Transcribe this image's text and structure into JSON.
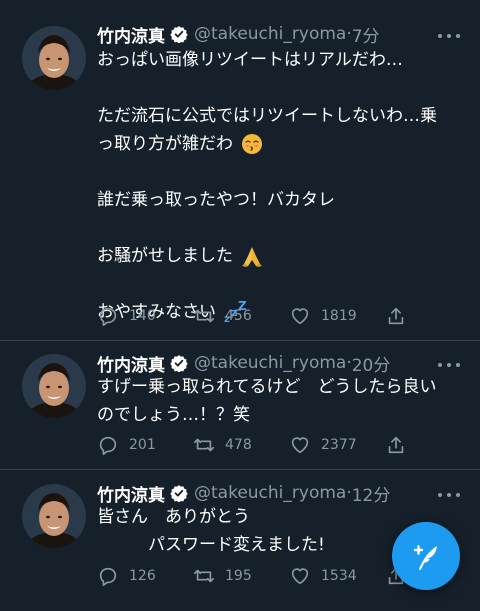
{
  "colors": {
    "background": "#15202b",
    "divider": "#38444d",
    "secondary_text": "#8b98a5",
    "accent": "#1d9bf0"
  },
  "tweets": [
    {
      "name": "竹内涼真",
      "handle": "@takeuchi_ryoma",
      "time": "7分",
      "lines": [
        "おっぱい画像リツイートはリアルだわ…",
        "",
        "ただ流石に公式ではリツイートしないわ…乗",
        "っ取り方が雑だわ",
        "",
        "誰だ乗っ取ったやつ！バカタレ",
        "",
        "お騒がせしました",
        "",
        "おやすみなさい"
      ],
      "replies": "140",
      "retweets": "456",
      "likes": "1819"
    },
    {
      "name": "竹内涼真",
      "handle": "@takeuchi_ryoma",
      "time": "20分",
      "lines": [
        "すげー乗っ取られてるけど　どうしたら良い",
        "のでしょう…！？笑"
      ],
      "replies": "201",
      "retweets": "478",
      "likes": "2377"
    },
    {
      "name": "竹内涼真",
      "handle": "@takeuchi_ryoma",
      "time": "12分",
      "lines": [
        "皆さん　ありがとう",
        "　　　パスワード変えました!"
      ],
      "replies": "126",
      "retweets": "195",
      "likes": "1534"
    }
  ],
  "icons": {
    "verified": "verified-badge-icon",
    "reply": "reply-icon",
    "retweet": "retweet-icon",
    "like": "heart-icon",
    "share": "share-icon",
    "more": "more-icon",
    "compose": "compose-tweet-icon"
  }
}
